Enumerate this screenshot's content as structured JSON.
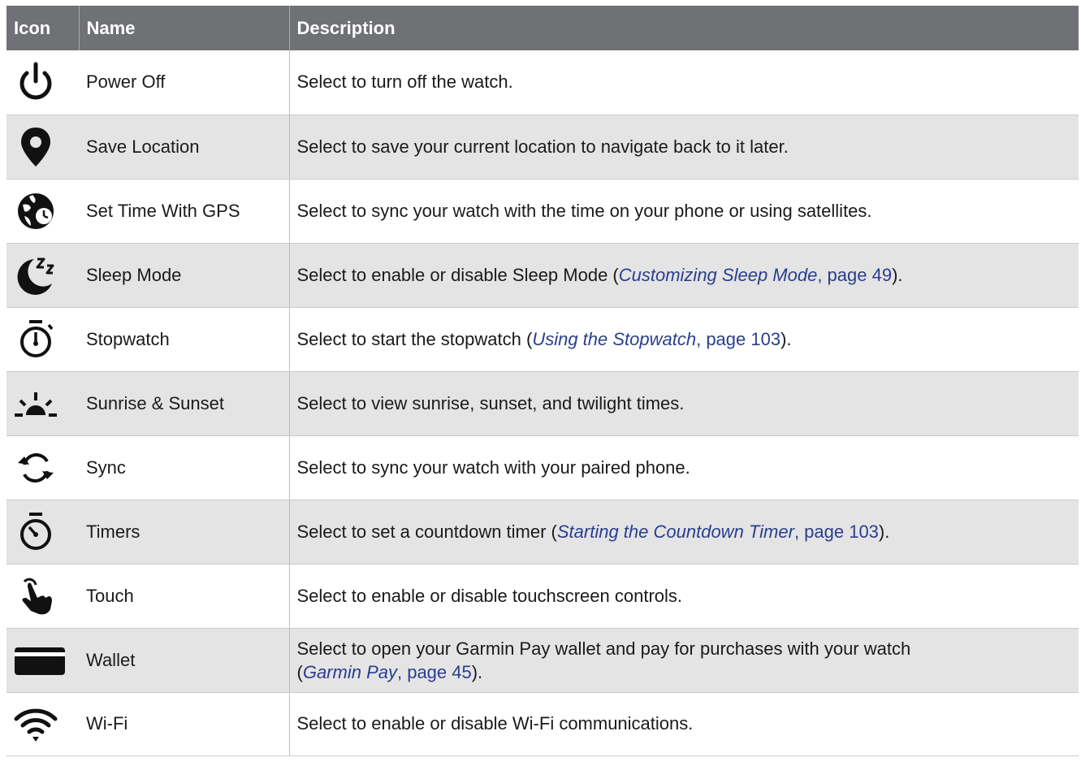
{
  "header": {
    "icon": "Icon",
    "name": "Name",
    "description": "Description"
  },
  "rows": [
    {
      "icon": "power-icon",
      "name": "Power Off",
      "desc": {
        "text": "Select to turn off the watch."
      }
    },
    {
      "icon": "location-pin-icon",
      "name": "Save Location",
      "desc": {
        "text": "Select to save your current location to navigate back to it later."
      }
    },
    {
      "icon": "globe-clock-icon",
      "name": "Set Time With GPS",
      "desc": {
        "text": "Select to sync your watch with the time on your phone or using satellites."
      }
    },
    {
      "icon": "moon-sleep-icon",
      "name": "Sleep Mode",
      "desc": {
        "before": "Select to enable or disable Sleep Mode (",
        "link_title": "Customizing Sleep Mode",
        "link_page": ", page 49",
        "after": ")."
      }
    },
    {
      "icon": "stopwatch-icon",
      "name": "Stopwatch",
      "desc": {
        "before": "Select to start the stopwatch (",
        "link_title": "Using the Stopwatch",
        "link_page": ", page 103",
        "after": ")."
      }
    },
    {
      "icon": "sunrise-icon",
      "name": "Sunrise & Sunset",
      "desc": {
        "text": "Select to view sunrise, sunset, and twilight times."
      }
    },
    {
      "icon": "sync-icon",
      "name": "Sync",
      "desc": {
        "text": "Select to sync your watch with your paired phone."
      }
    },
    {
      "icon": "timer-icon",
      "name": "Timers",
      "desc": {
        "before": "Select to set a countdown timer (",
        "link_title": "Starting the Countdown Timer",
        "link_page": ", page 103",
        "after": ")."
      }
    },
    {
      "icon": "touch-hand-icon",
      "name": "Touch",
      "desc": {
        "text": "Select to enable or disable touchscreen controls."
      }
    },
    {
      "icon": "wallet-card-icon",
      "name": "Wallet",
      "desc": {
        "line1": "Select to open your Garmin Pay wallet and pay for purchases with your watch",
        "before": "(",
        "link_title": "Garmin Pay",
        "link_page": ", page 45",
        "after": ")."
      }
    },
    {
      "icon": "wifi-icon",
      "name": "Wi-Fi",
      "desc": {
        "text": "Select to enable or disable Wi-Fi communications."
      }
    }
  ],
  "colors": {
    "header_bg": "#6f7175",
    "zebra": "#e4e4e4",
    "link": "#2a3e8f"
  }
}
